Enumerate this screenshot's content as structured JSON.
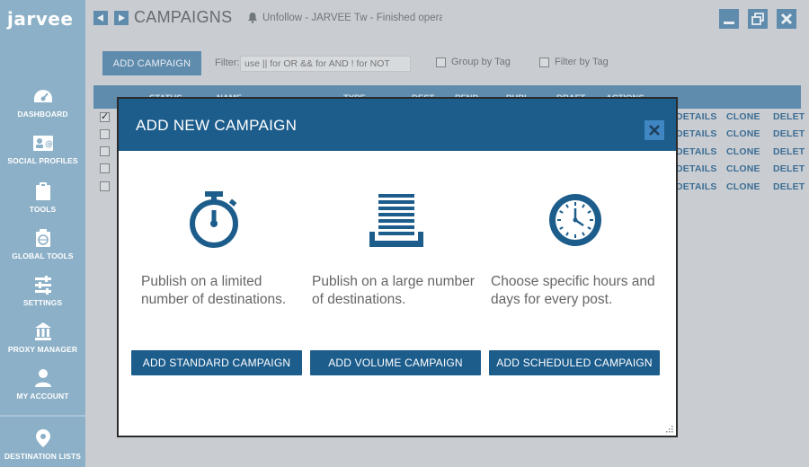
{
  "app": {
    "logo": "jarvee",
    "page_title": "CAMPAIGNS",
    "notification": "Unfollow - JARVEE Tw - Finished operat"
  },
  "sidebar": {
    "items": [
      {
        "label": "DASHBOARD",
        "icon": "dashboard-icon"
      },
      {
        "label": "SOCIAL PROFILES",
        "icon": "social-profiles-icon"
      },
      {
        "label": "TOOLS",
        "icon": "tools-icon"
      },
      {
        "label": "GLOBAL TOOLS",
        "icon": "global-tools-icon"
      },
      {
        "label": "SETTINGS",
        "icon": "settings-icon"
      },
      {
        "label": "PROXY MANAGER",
        "icon": "proxy-manager-icon"
      },
      {
        "label": "MY ACCOUNT",
        "icon": "my-account-icon"
      },
      {
        "label": "DESTINATION LISTS",
        "icon": "location-pin-icon"
      }
    ]
  },
  "toolbar": {
    "add_campaign_label": "ADD CAMPAIGN",
    "filter_label": "Filter:",
    "filter_placeholder": "use || for OR && for AND ! for NOT",
    "group_by_tag_label": "Group by Tag",
    "filter_by_tag_label": "Filter by Tag"
  },
  "table": {
    "columns": [
      "STATUS",
      "NAME",
      "TYPE",
      "DEST.",
      "PEND.",
      "PUBL.",
      "DRAFT",
      "ACTIONS"
    ],
    "row_actions": [
      "DETAILS",
      "CLONE",
      "DELET"
    ],
    "rows": [
      {
        "checked": true
      },
      {
        "checked": false
      },
      {
        "checked": false
      },
      {
        "checked": false
      },
      {
        "checked": false
      }
    ]
  },
  "modal": {
    "title": "ADD NEW CAMPAIGN",
    "options": [
      {
        "icon": "stopwatch-icon",
        "description": "Publish on a limited number of destinations.",
        "button_label": "ADD STANDARD CAMPAIGN"
      },
      {
        "icon": "stacked-list-icon",
        "description": "Publish on a large number of destinations.",
        "button_label": "ADD VOLUME CAMPAIGN"
      },
      {
        "icon": "clock-icon",
        "description": "Choose specific hours and days for every post.",
        "button_label": "ADD SCHEDULED CAMPAIGN"
      }
    ]
  },
  "colors": {
    "modal_header": "#1d5d8c",
    "modal_button": "#1d5d8c",
    "sidebar": "#8cb0c7",
    "overlay": "#c9cdd1"
  }
}
